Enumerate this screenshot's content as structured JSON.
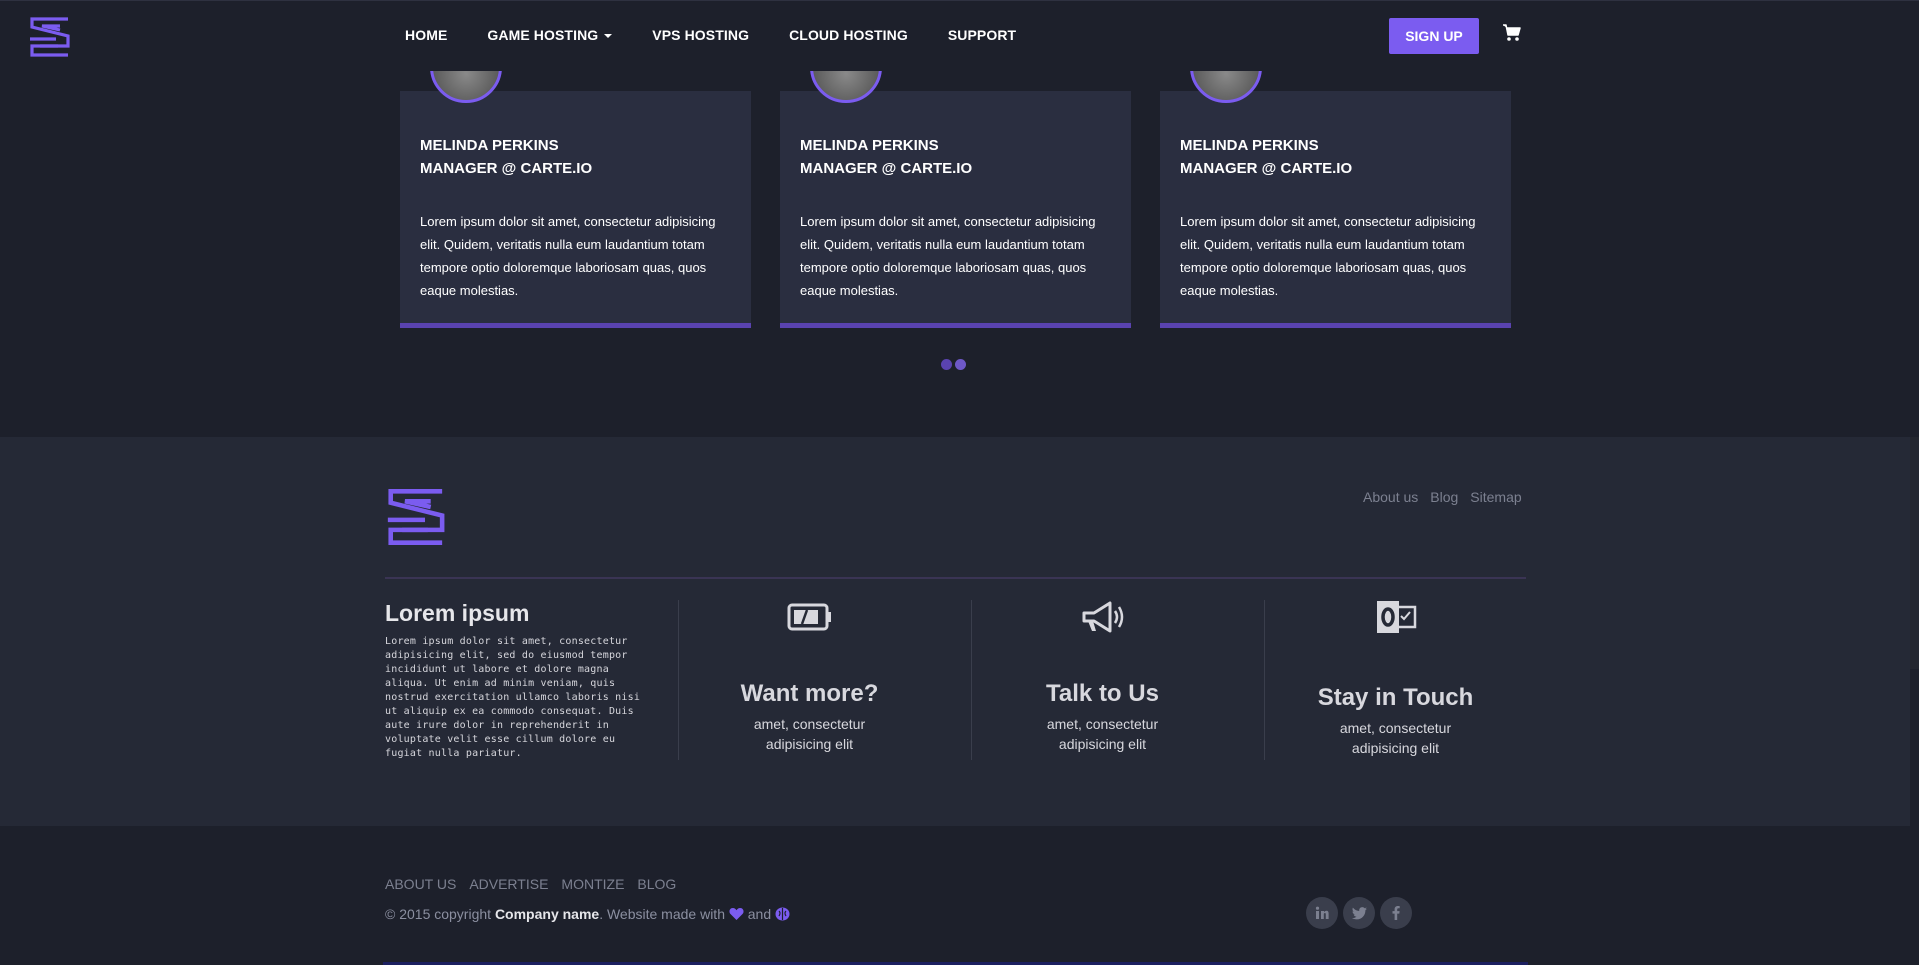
{
  "nav": {
    "links": [
      {
        "label": "HOME"
      },
      {
        "label": "GAME HOSTING",
        "dropdown": true
      },
      {
        "label": "VPS HOSTING"
      },
      {
        "label": "CLOUD HOSTING"
      },
      {
        "label": "SUPPORT"
      }
    ],
    "signup_label": "SIGN UP",
    "cart_icon": "shopping-cart-icon",
    "logo_icon": "s-logo-icon"
  },
  "testimonials": [
    {
      "name": "MELINDA PERKINS",
      "role": "MANAGER @ CARTE.IO",
      "text": "Lorem ipsum dolor sit amet, consectetur adipisicing elit. Quidem, veritatis nulla eum laudantium totam tempore optio doloremque laboriosam quas, quos eaque molestias."
    },
    {
      "name": "MELINDA PERKINS",
      "role": "MANAGER @ CARTE.IO",
      "text": "Lorem ipsum dolor sit amet, consectetur adipisicing elit. Quidem, veritatis nulla eum laudantium totam tempore optio doloremque laboriosam quas, quos eaque molestias."
    },
    {
      "name": "MELINDA PERKINS",
      "role": "MANAGER @ CARTE.IO",
      "text": "Lorem ipsum dolor sit amet, consectetur adipisicing elit. Quidem, veritatis nulla eum laudantium totam tempore optio doloremque laboriosam quas, quos eaque molestias."
    }
  ],
  "carousel": {
    "dots": 2,
    "active": 1
  },
  "footer": {
    "links": [
      "About us",
      "Blog",
      "Sitemap"
    ],
    "about": {
      "title": "Lorem ipsum",
      "text": "Lorem ipsum dolor sit amet, consectetur adipisicing elit, sed do eiusmod tempor incididunt ut labore et dolore magna aliqua. Ut enim ad minim veniam, quis nostrud exercitation ullamco laboris nisi ut aliquip ex ea commodo consequat. Duis aute irure dolor in reprehenderit in voluptate velit esse cillum dolore eu fugiat nulla pariatur."
    },
    "features": [
      {
        "icon": "battery-icon",
        "title": "Want more?",
        "text": "amet, consectetur adipisicing elit"
      },
      {
        "icon": "megaphone-icon",
        "title": "Talk to Us",
        "text": "amet, consectetur adipisicing elit"
      },
      {
        "icon": "outlook-icon",
        "title": "Stay in Touch",
        "text": "amet, consectetur adipisicing elit"
      }
    ]
  },
  "bottom": {
    "links": [
      "ABOUT US",
      "ADVERTISE",
      "MONTIZE",
      "BLOG"
    ],
    "copyright_prefix": "© 2015 copyright ",
    "company": "Company name",
    "copyright_mid": ". Website made with ",
    "copyright_and": " and ",
    "heart_icon": "heart-icon",
    "brain_icon": "brain-icon",
    "socials": [
      "linkedin-icon",
      "twitter-icon",
      "facebook-icon"
    ]
  },
  "colors": {
    "accent": "#7b5cf0",
    "background": "#1d202b",
    "card": "#2a2e40",
    "footer": "#252936"
  }
}
